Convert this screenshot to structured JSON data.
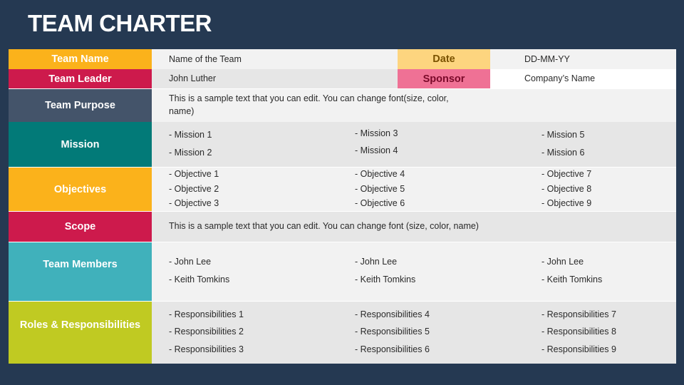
{
  "title": "TEAM CHARTER",
  "header": {
    "team_name_label": "Team Name",
    "team_name_value": "Name of the Team",
    "date_label": "Date",
    "date_value": "DD-MM-YY",
    "team_leader_label": "Team Leader",
    "team_leader_value": "John Luther",
    "sponsor_label": "Sponsor",
    "sponsor_value": "Company’s Name"
  },
  "purpose": {
    "label": "Team Purpose",
    "text": "This is a sample text that you can edit. You can change font(size, color, name)"
  },
  "mission": {
    "label": "Mission",
    "items": [
      "- Mission 1",
      "- Mission 2",
      "- Mission 3",
      "- Mission 4",
      "- Mission 5",
      "- Mission 6"
    ]
  },
  "objectives": {
    "label": "Objectives",
    "items": [
      "- Objective 1",
      "- Objective 2",
      "- Objective 3",
      "- Objective 4",
      "- Objective 5",
      "- Objective 6",
      "- Objective 7",
      "- Objective 8",
      "- Objective 9"
    ]
  },
  "scope": {
    "label": "Scope",
    "text": "This is a sample text that you can edit. You can change font (size, color, name)"
  },
  "members": {
    "label": "Team Members",
    "items": [
      "- John Lee",
      "- Keith Tomkins",
      "- John Lee",
      "- Keith Tomkins",
      "- John Lee",
      "- Keith Tomkins"
    ]
  },
  "roles": {
    "label": "Roles & Responsibilities",
    "items": [
      "- Responsibilities 1",
      "- Responsibilities 2",
      "- Responsibilities 3",
      "- Responsibilities 4",
      "- Responsibilities 5",
      "- Responsibilities 6",
      "- Responsibilities 7",
      "- Responsibilities 8",
      "- Responsibilities 9"
    ]
  },
  "colors": {
    "background": "#253952",
    "orange": "#fbb21b",
    "crimson": "#cd1a4c",
    "slate": "#44546a",
    "teal": "#027a78",
    "cyan": "#40b1bb",
    "lime": "#c0ca22",
    "date_bg": "#fdd57f",
    "sponsor_bg": "#ef7195"
  }
}
